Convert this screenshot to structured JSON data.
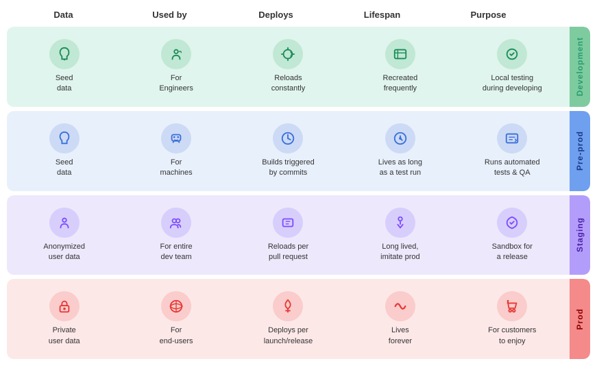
{
  "headers": [
    "Data",
    "Used by",
    "Deploys",
    "Lifespan",
    "Purpose"
  ],
  "sections": [
    {
      "id": "development",
      "label": "Development",
      "bgClass": "dev-bg",
      "iconClass": "dev-icon",
      "labelBgClass": "dev-label-bg",
      "labelColor": "#2a9d6d",
      "bgColor": "#e0f5ed",
      "iconBg": "#c0e8d4",
      "iconColor": "#1b8a57",
      "labelBg": "#7ecba0",
      "cells": [
        {
          "icon": "🌱",
          "label": "Seed\ndata"
        },
        {
          "icon": "👷",
          "label": "For\nEngineers"
        },
        {
          "icon": "🔄",
          "label": "Reloads\nconstantly"
        },
        {
          "icon": "🔁",
          "label": "Recreated\nfrequently"
        },
        {
          "icon": "🔧",
          "label": "Local testing\nduring developing"
        }
      ]
    },
    {
      "id": "pre-prod",
      "label": "Pre-prod",
      "bgColor": "#e8f0fb",
      "iconBg": "#ccdaf5",
      "iconColor": "#3a6edb",
      "labelBg": "#6fa0ef",
      "labelColor": "#1a3a8a",
      "cells": [
        {
          "icon": "🌱",
          "label": "Seed\ndata"
        },
        {
          "icon": "🤖",
          "label": "For\nmachines"
        },
        {
          "icon": "⌚",
          "label": "Builds triggered\nby commits"
        },
        {
          "icon": "⏱",
          "label": "Lives as long\nas a test run"
        },
        {
          "icon": "📋",
          "label": "Runs automated\ntests & QA"
        }
      ]
    },
    {
      "id": "staging",
      "label": "Staging",
      "bgColor": "#ede8fc",
      "iconBg": "#d8cefc",
      "iconColor": "#7c4dff",
      "labelBg": "#b39dfa",
      "labelColor": "#4a1fa8",
      "cells": [
        {
          "icon": "🕵️",
          "label": "Anonymized\nuser data"
        },
        {
          "icon": "👥",
          "label": "For entire\ndev team"
        },
        {
          "icon": "💬",
          "label": "Reloads per\npull request"
        },
        {
          "icon": "🚶",
          "label": "Long lived,\nimitate prod"
        },
        {
          "icon": "☂",
          "label": "Sandbox for\na release"
        }
      ]
    },
    {
      "id": "prod",
      "label": "Prod",
      "bgColor": "#fde8e8",
      "iconBg": "#facccc",
      "iconColor": "#e53935",
      "labelBg": "#f48a8a",
      "labelColor": "#8b0000",
      "cells": [
        {
          "icon": "🔒",
          "label": "Private\nuser data"
        },
        {
          "icon": "🌐",
          "label": "For\nend-users"
        },
        {
          "icon": "🚀",
          "label": "Deploys per\nlaunch/release"
        },
        {
          "icon": "∞",
          "label": "Lives\nforever"
        },
        {
          "icon": "🛒",
          "label": "For customers\nto enjoy"
        }
      ]
    }
  ]
}
